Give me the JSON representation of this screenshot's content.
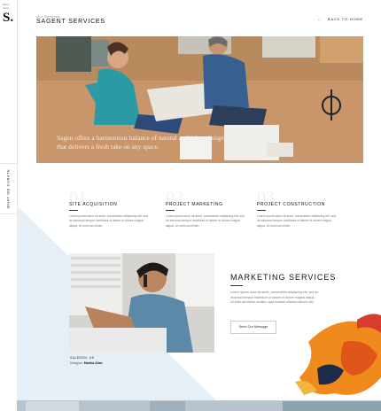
{
  "sidebar": {
    "tiny_text": "Menu Open",
    "logo": "S.",
    "vertical_tab": "WHAT WE CURATE"
  },
  "header": {
    "eyebrow": "Our Services",
    "title": "SAGENT SERVICES",
    "back_label": "BACK TO HOME",
    "back_icon": "arrow-left-icon"
  },
  "hero": {
    "caption": "Sagen offers a harmonious balance of natural and urban design that delivers a fresh take on any space."
  },
  "services": [
    {
      "num": "01",
      "title": "SITE ACQUISITION",
      "text": "Lorem ipsum dolor sit amet, consectetur adipiscing elit, sed do eiusmod tempor incididunt ut labore et dolore magna aliqua. Ut enim ad minim."
    },
    {
      "num": "02",
      "title": "PROJECT MARKETING",
      "text": "Lorem ipsum dolor sit amet, consectetur adipiscing elit, sed do eiusmod tempor incididunt ut labore et dolore magna aliqua. Ut enim ad minim."
    },
    {
      "num": "03",
      "title": "PROJECT CONSTRUCTION",
      "text": "Lorem ipsum dolor sit amet, consectetur adipiscing elit, sed do eiusmod tempor incididunt ut labore et dolore magna aliqua. Ut enim ad minim."
    }
  ],
  "marketing": {
    "location": "SALEDEN, UK",
    "designer_label": "Designer,",
    "designer_name": "Martha Allan",
    "title": "MARKETING SERVICES",
    "text": "Lorem ipsum dolor sit amet, consectetur adipiscing elit, sed do eiusmod tempor incididunt ut labore et dolore magna aliqua. Ut enim ad minim veniam, quis nostrud ullamco laboris nisi.",
    "button": "Send Our Message"
  },
  "colors": {
    "accent_blue": "#e6eef6",
    "splash_orange": "#f08a1c"
  }
}
